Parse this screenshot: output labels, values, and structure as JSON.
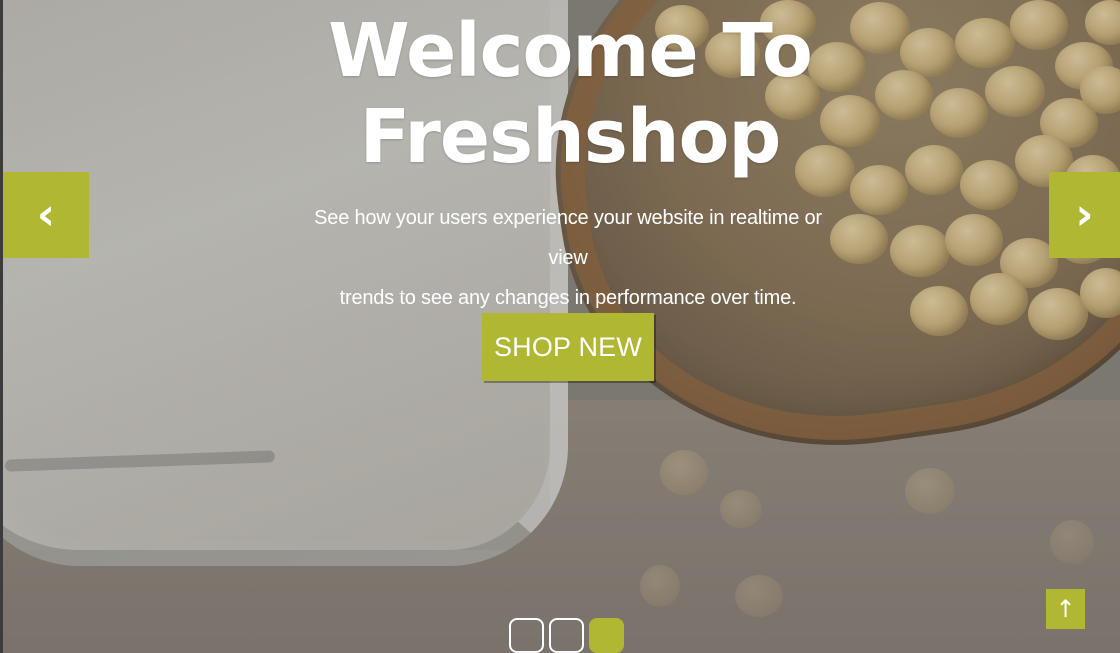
{
  "hero": {
    "title_line_1": "Welcome To",
    "title_line_2": "Freshshop",
    "subtitle_line_1": "See how your users experience your website in realtime or view",
    "subtitle_line_2": "trends to see any changes in performance over time.",
    "button_label": "SHOP NEW",
    "active_slide": 3,
    "slide_count": 3
  },
  "controls": {
    "previous_icon": "chevron-left-icon",
    "next_icon": "chevron-right-icon",
    "back_to_top_icon": "arrow-up-icon",
    "previous_glyph": "‹",
    "next_glyph": "›",
    "back_to_top_glyph": "↑"
  },
  "colors": {
    "accent": "#b0b733",
    "text": "#ffffff"
  }
}
